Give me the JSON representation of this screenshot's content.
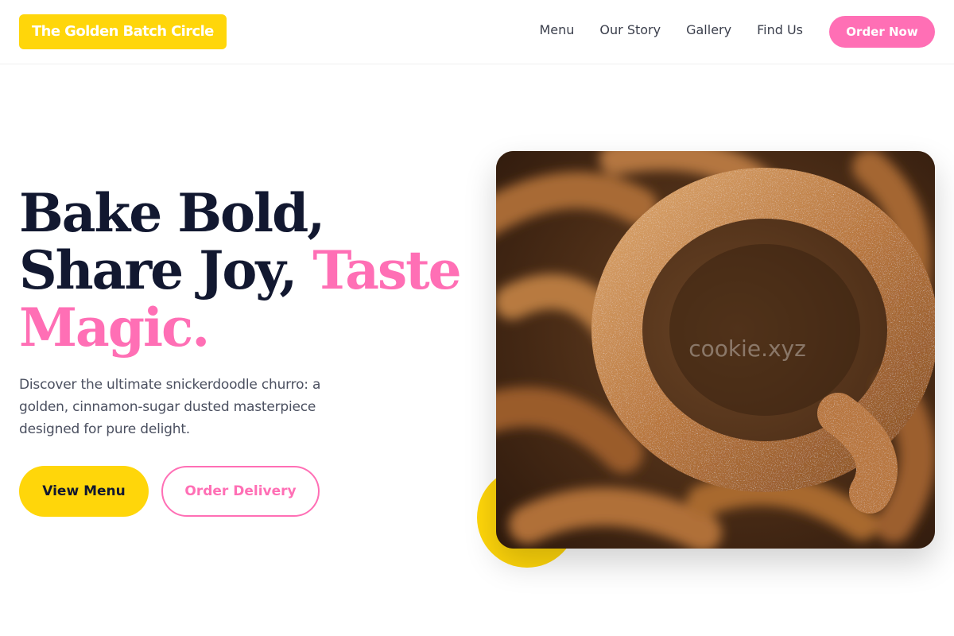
{
  "brand": {
    "name": "The Golden Batch Circle"
  },
  "nav": {
    "links": [
      "Menu",
      "Our Story",
      "Gallery",
      "Find Us"
    ],
    "cta": "Order Now"
  },
  "hero": {
    "title_line1": "Bake Bold,",
    "title_line2": "Share Joy,",
    "title_accent": "Taste Magic.",
    "description": "Discover the ultimate snickerdoodle churro: a golden, cinnamon-sugar dusted masterpiece designed for pure delight.",
    "primary_button": "View Menu",
    "secondary_button": "Order Delivery",
    "image_alt": "Cinnamon-sugar dusted churro ring",
    "watermark": "cookie.xyz"
  },
  "colors": {
    "brand_yellow": "#FFD60A",
    "accent_pink": "#FF6FB5",
    "heading_navy": "#121830",
    "body_gray": "#4b5060"
  },
  "icons": {
    "hero_image": "churro-photo"
  }
}
